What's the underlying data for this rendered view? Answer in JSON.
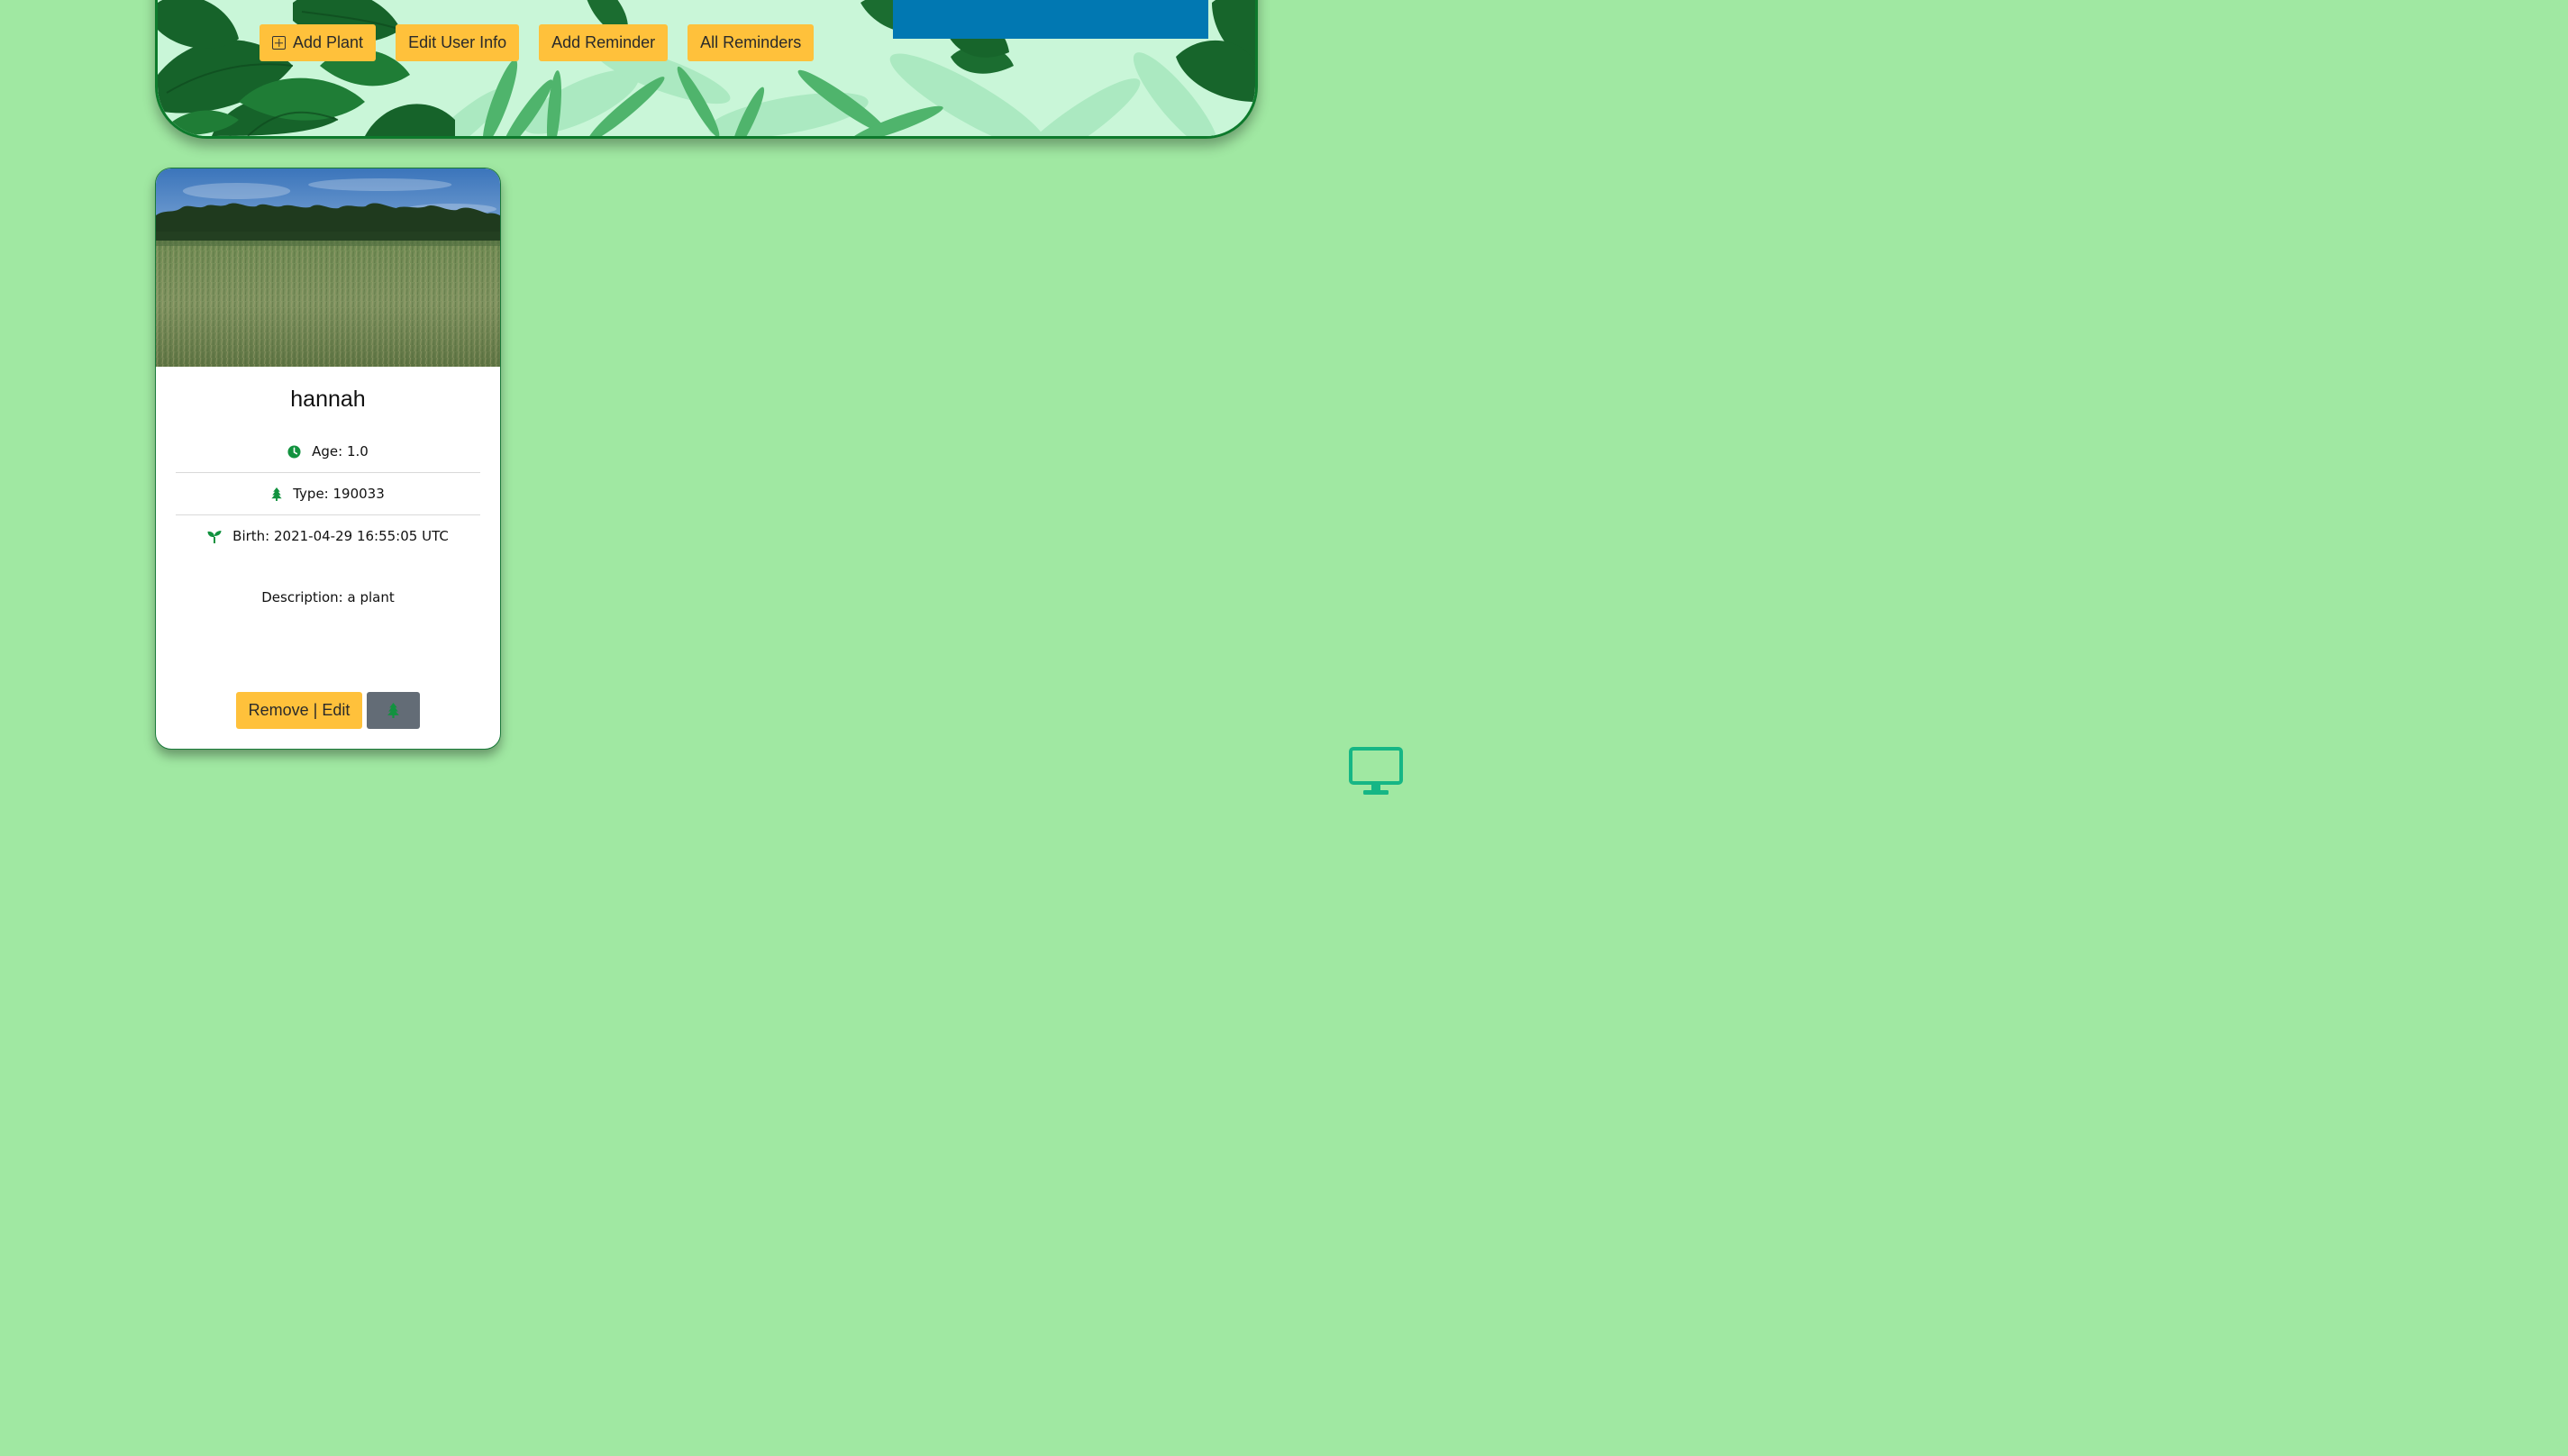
{
  "nav": {
    "add_plant": "Add Plant",
    "edit_user_info": "Edit User Info",
    "add_reminder": "Add Reminder",
    "all_reminders": "All Reminders"
  },
  "plant": {
    "name": "hannah",
    "age_label": "Age: 1.0",
    "type_label": "Type: 190033",
    "birth_label": "Birth: 2021-04-29 16:55:05 UTC",
    "description_label": "Description: a plant",
    "remove_edit_label": "Remove | Edit"
  },
  "icons": {
    "add": "plus-square-icon",
    "age": "clock-icon",
    "type": "tree-icon",
    "birth": "seedling-icon",
    "water": "tree-icon",
    "corner": "desktop-monitor-icon"
  },
  "colors": {
    "page_bg": "#a0e8a2",
    "button": "#ffc13b",
    "accent_green": "#12923f",
    "header_border": "#0d7a2c",
    "blue_panel": "#0178b2",
    "grey_button": "#636c76",
    "monitor": "#16b685"
  }
}
